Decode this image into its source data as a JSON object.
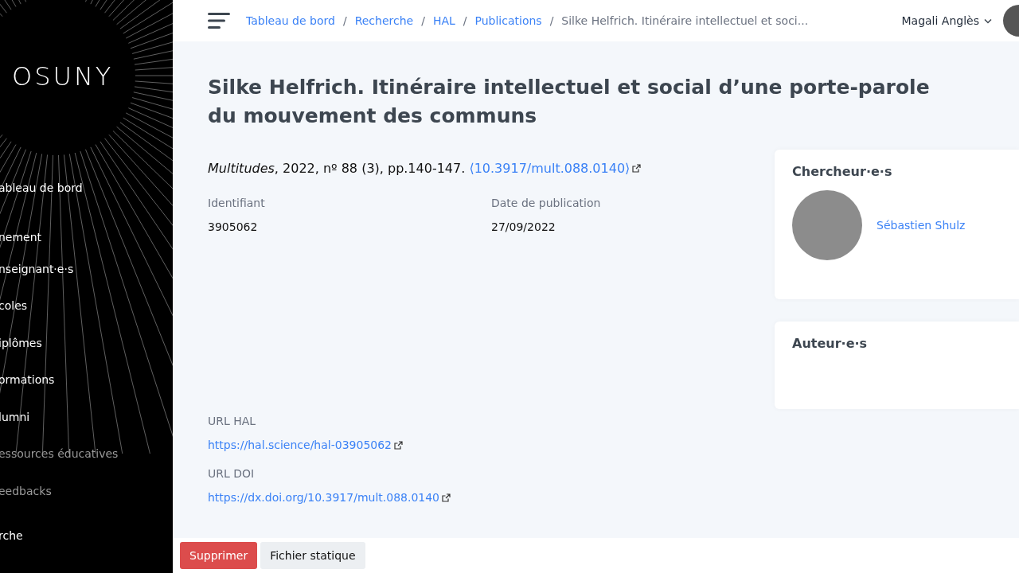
{
  "sidebar": {
    "logo": "OSUNY",
    "items": [
      {
        "label": "ableau de bord",
        "muted": false
      },
      {
        "label": "nement",
        "muted": false
      },
      {
        "label": "nseignant·e·s",
        "muted": false
      },
      {
        "label": "coles",
        "muted": false
      },
      {
        "label": "iplômes",
        "muted": false
      },
      {
        "label": "ormations",
        "muted": false
      },
      {
        "label": "lumni",
        "muted": false
      },
      {
        "label": "essources éducatives",
        "muted": true
      },
      {
        "label": "eedbacks",
        "muted": true
      },
      {
        "label": "rche",
        "muted": false
      }
    ]
  },
  "topbar": {
    "breadcrumbs": [
      {
        "label": "Tableau de bord",
        "link": true
      },
      {
        "label": "Recherche",
        "link": true
      },
      {
        "label": "HAL",
        "link": true
      },
      {
        "label": "Publications",
        "link": true
      },
      {
        "label": "Silke Helfrich. Itinéraire intellectuel et soci...",
        "link": false
      }
    ],
    "separator": "/",
    "user": "Magali Anglès"
  },
  "publication": {
    "title": "Silke Helfrich. Itinéraire intellectuel et social d’une porte-parole du mouvement des communs",
    "citation": "*Multitudes*, 2022, nº 88 (3), pp.140-147.",
    "doi_link": "⟨10.3917/mult.088.0140⟩",
    "fields": [
      {
        "label": "Identifiant",
        "value": "3905062"
      },
      {
        "label": "Date de publication",
        "value": "27/09/2022"
      }
    ],
    "links": [
      {
        "label": "URL HAL",
        "url": "https://hal.science/hal-03905062"
      },
      {
        "label": "URL DOI",
        "url": "https://dx.doi.org/10.3917/mult.088.0140"
      }
    ]
  },
  "cards": [
    {
      "title": "Chercheur·e·s",
      "people": [
        {
          "name": "Sébastien Shulz"
        }
      ]
    },
    {
      "title": "Auteur·e·s"
    }
  ],
  "actions": [
    {
      "label": "Supprimer",
      "kind": "danger"
    },
    {
      "label": "Fichier statique",
      "kind": "secondary"
    }
  ]
}
